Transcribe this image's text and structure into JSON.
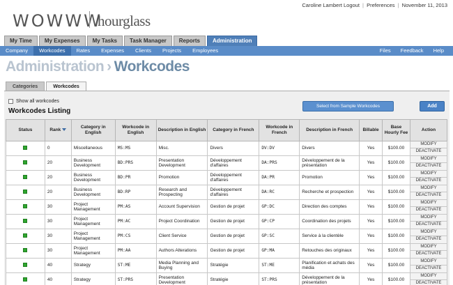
{
  "header": {
    "logo_left": "WOWWW",
    "logo_right": "hourglass",
    "user": "Caroline Lambert",
    "logout": "Logout",
    "preferences": "Preferences",
    "date": "November 11, 2013"
  },
  "main_tabs": [
    {
      "label": "My Time",
      "active": false
    },
    {
      "label": "My Expenses",
      "active": false
    },
    {
      "label": "My Tasks",
      "active": false
    },
    {
      "label": "Task Manager",
      "active": false
    },
    {
      "label": "Reports",
      "active": false
    },
    {
      "label": "Administration",
      "active": true
    }
  ],
  "sub_nav": [
    {
      "label": "Company",
      "active": false
    },
    {
      "label": "Workcodes",
      "active": true
    },
    {
      "label": "Rates",
      "active": false
    },
    {
      "label": "Expenses",
      "active": false
    },
    {
      "label": "Clients",
      "active": false
    },
    {
      "label": "Projects",
      "active": false
    },
    {
      "label": "Employees",
      "active": false
    }
  ],
  "sub_nav_right": [
    "Files",
    "Feedback",
    "Help"
  ],
  "page_title": {
    "section": "Administration",
    "separator": "›",
    "page": "Workcodes"
  },
  "content_tabs": [
    {
      "label": "Categories",
      "active": false
    },
    {
      "label": "Workcodes",
      "active": true
    }
  ],
  "listing": {
    "show_all_label": "Show all workcodes",
    "title": "Workcodes Listing",
    "sample_button": "Select from Sample Workcodes",
    "add_button": "Add"
  },
  "table": {
    "columns": [
      "Status",
      "Rank",
      "Category in English",
      "Workcode in English",
      "Description in English",
      "Category in French",
      "Workcode in French",
      "Description in French",
      "Billable",
      "Base Hourly Fee",
      "Action"
    ],
    "modify_label": "MODIFY",
    "deactivate_label": "DEACTIVATE",
    "rows": [
      {
        "rank": "0",
        "cat_en": "Miscellaneous",
        "code_en": "MS:MS",
        "desc_en": "Misc.",
        "cat_fr": "Divers",
        "code_fr": "DV:DV",
        "desc_fr": "Divers",
        "billable": "Yes",
        "fee": "$100.00"
      },
      {
        "rank": "20",
        "cat_en": "Business Development",
        "code_en": "BD:PRS",
        "desc_en": "Presentation Development",
        "cat_fr": "Développement d'affaires",
        "code_fr": "DA:PRS",
        "desc_fr": "Développement de la présentation",
        "billable": "Yes",
        "fee": "$100.00"
      },
      {
        "rank": "20",
        "cat_en": "Business Development",
        "code_en": "BD:PR",
        "desc_en": "Promotion",
        "cat_fr": "Développement d'affaires",
        "code_fr": "DA:PR",
        "desc_fr": "Promotion",
        "billable": "Yes",
        "fee": "$100.00"
      },
      {
        "rank": "20",
        "cat_en": "Business Development",
        "code_en": "BD:RP",
        "desc_en": "Research and Prospecting",
        "cat_fr": "Développement d'affaires",
        "code_fr": "DA:RC",
        "desc_fr": "Recherche et prospection",
        "billable": "Yes",
        "fee": "$100.00"
      },
      {
        "rank": "30",
        "cat_en": "Project Management",
        "code_en": "PM:AS",
        "desc_en": "Account Supervision",
        "cat_fr": "Gestion de projet",
        "code_fr": "GP:DC",
        "desc_fr": "Direction des comptes",
        "billable": "Yes",
        "fee": "$100.00"
      },
      {
        "rank": "30",
        "cat_en": "Project Management",
        "code_en": "PM:AC",
        "desc_en": "Project Coordination",
        "cat_fr": "Gestion de projet",
        "code_fr": "GP:CP",
        "desc_fr": "Coordination des projets",
        "billable": "Yes",
        "fee": "$100.00"
      },
      {
        "rank": "30",
        "cat_en": "Project Management",
        "code_en": "PM:CS",
        "desc_en": "Client Service",
        "cat_fr": "Gestion de projet",
        "code_fr": "GP:SC",
        "desc_fr": "Service à la clientèle",
        "billable": "Yes",
        "fee": "$100.00"
      },
      {
        "rank": "30",
        "cat_en": "Project Management",
        "code_en": "PM:AA",
        "desc_en": "Authors Alterations",
        "cat_fr": "Gestion de projet",
        "code_fr": "GP:MA",
        "desc_fr": "Retouches des originaux",
        "billable": "Yes",
        "fee": "$100.00"
      },
      {
        "rank": "40",
        "cat_en": "Strategy",
        "code_en": "ST:ME",
        "desc_en": "Media Planning and Buying",
        "cat_fr": "Stratégie",
        "code_fr": "ST:ME",
        "desc_fr": "Planification et achats des média",
        "billable": "Yes",
        "fee": "$100.00"
      },
      {
        "rank": "40",
        "cat_en": "Strategy",
        "code_en": "ST:PRS",
        "desc_en": "Presentation Development",
        "cat_fr": "Stratégie",
        "code_fr": "ST:PRS",
        "desc_fr": "Développement de la présentation",
        "billable": "Yes",
        "fee": "$100.00"
      }
    ]
  },
  "colors": {
    "accent": "#4f7fb8",
    "subnav": "#5a8cc8",
    "status_active": "#2fa62f"
  }
}
